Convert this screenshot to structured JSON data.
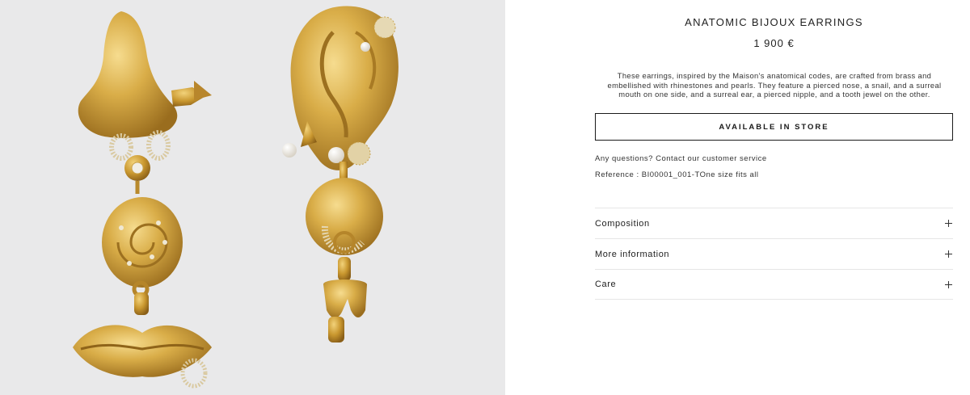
{
  "product": {
    "image_alt": "Anatomic Bijoux Earrings gold earrings",
    "title": "ANATOMIC BIJOUX EARRINGS",
    "price": "1 900 €",
    "description": "These earrings, inspired by the Maison's anatomical codes, are crafted from brass and embellished with rhinestones and pearls. They feature a pierced nose, a snail, and a surreal mouth on one side, and a surreal ear, a pierced nipple, and a tooth jewel on the other.",
    "availability_button": "AVAILABLE IN STORE",
    "questions_text": "Any questions? Contact our customer service",
    "reference_text": "Reference : BI00001_001-TOne size fits all"
  },
  "accordion": [
    {
      "label": "Composition",
      "icon": "plus-icon"
    },
    {
      "label": "More information",
      "icon": "plus-icon"
    },
    {
      "label": "Care",
      "icon": "plus-icon"
    }
  ],
  "colors": {
    "image_background": "#e9e9ea",
    "gold": "#d4a640",
    "text": "#1a1a1a"
  }
}
